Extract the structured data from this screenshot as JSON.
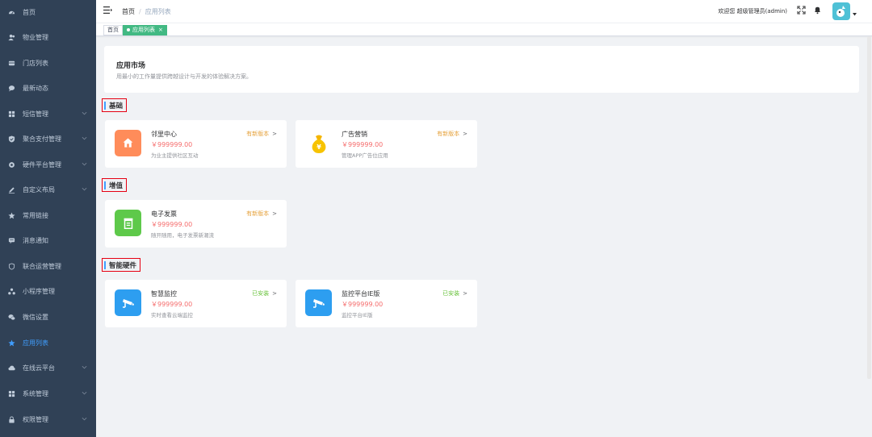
{
  "sidebar": {
    "items": [
      {
        "label": "首页",
        "icon": "dashboard-icon"
      },
      {
        "label": "物业管理",
        "icon": "users-icon"
      },
      {
        "label": "门店列表",
        "icon": "store-icon"
      },
      {
        "label": "最新动态",
        "icon": "chat-icon"
      },
      {
        "label": "短信管理",
        "icon": "grid-icon",
        "expandable": true
      },
      {
        "label": "聚合支付管理",
        "icon": "shield-icon",
        "expandable": true
      },
      {
        "label": "硬件平台管理",
        "icon": "gear-icon",
        "expandable": true
      },
      {
        "label": "自定义布局",
        "icon": "edit-icon",
        "expandable": true
      },
      {
        "label": "常用链接",
        "icon": "star-icon"
      },
      {
        "label": "消息通知",
        "icon": "message-icon"
      },
      {
        "label": "联合运营管理",
        "icon": "shield-outline-icon"
      },
      {
        "label": "小程序管理",
        "icon": "cluster-icon"
      },
      {
        "label": "微信设置",
        "icon": "wechat-icon"
      },
      {
        "label": "应用列表",
        "icon": "star-icon",
        "active": true
      },
      {
        "label": "在线云平台",
        "icon": "cloud-icon",
        "expandable": true
      },
      {
        "label": "系统管理",
        "icon": "grid-icon",
        "expandable": true
      },
      {
        "label": "权限管理",
        "icon": "lock-icon",
        "expandable": true
      }
    ]
  },
  "header": {
    "breadcrumb": {
      "home": "首页",
      "separator": "/",
      "current": "应用列表"
    },
    "welcome": "欢迎您 超级管理员(admin)"
  },
  "tags": {
    "home": "首页",
    "active": "应用列表",
    "close": "×"
  },
  "intro": {
    "title": "应用市场",
    "subtitle": "用最小的工作量提供跨越设计与开发的体验解决方案。"
  },
  "sections": [
    {
      "title": "基础",
      "cards": [
        {
          "name": "邻里中心",
          "price": "￥999999.00",
          "desc": "为业主提供社区互动",
          "status": "有新版本",
          "status_type": "new",
          "icon": "home-icon",
          "color": "#ff8c5a"
        },
        {
          "name": "广告营销",
          "price": "￥999999.00",
          "desc": "管理APP广告位应用",
          "status": "有新版本",
          "status_type": "new",
          "icon": "money-bag-icon",
          "color": "#ffffff"
        }
      ]
    },
    {
      "title": "增值",
      "cards": [
        {
          "name": "电子发票",
          "price": "￥999999.00",
          "desc": "随开随用，电子发票新潮流",
          "status": "有新版本",
          "status_type": "new",
          "icon": "invoice-icon",
          "color": "#5ec94a"
        }
      ]
    },
    {
      "title": "智能硬件",
      "cards": [
        {
          "name": "智慧监控",
          "price": "￥999999.00",
          "desc": "实时查看云端监控",
          "status": "已安装",
          "status_type": "installed",
          "icon": "camera-icon",
          "color": "#2d9ef0"
        },
        {
          "name": "监控平台IE版",
          "price": "￥999999.00",
          "desc": "监控平台IE版",
          "status": "已安装",
          "status_type": "installed",
          "icon": "camera-icon",
          "color": "#2d9ef0"
        }
      ]
    }
  ]
}
